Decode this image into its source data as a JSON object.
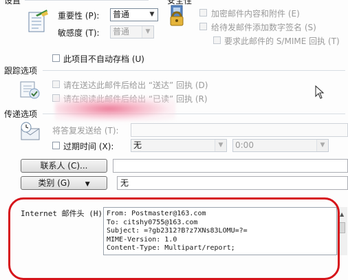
{
  "settings": {
    "title": "设置",
    "importance_label": "重要性 (P):",
    "importance_value": "普通",
    "sensitivity_label": "敏感度 (T):",
    "sensitivity_value": "普通",
    "no_autoarchive": "此项目不自动存档 (U)"
  },
  "security": {
    "title": "安全性",
    "encrypt": "加密邮件内容和附件 (E)",
    "sign": "给待发邮件添加数字签名 (S)",
    "smime_receipt": "要求此邮件的 S/MIME 回执 (T)"
  },
  "tracking": {
    "title": "跟踪选项",
    "delivery_receipt": "请在送达此邮件后给出 “送达” 回执 (D)",
    "read_receipt": "请在阅读此邮件后给出 “已读” 回执 (R)"
  },
  "delivery": {
    "title": "传递选项",
    "reply_to_label": "将答复发送给 (T):",
    "expires_label": "过期时间 (X):",
    "expires_date": "无",
    "expires_time": "0:00"
  },
  "contacts_button": "联系人 (C)...",
  "category_button": "类别 (G)",
  "category_value": "无",
  "headers": {
    "label": "Internet 邮件头 (H):",
    "lines": [
      "From: Postmaster@163.com",
      "To: citshy0755@163.com",
      "Subject: =?gb2312?B?z7XNs83LOMU=?=",
      "MIME-Version: 1.0",
      "Content-Type: Multipart/report;"
    ]
  },
  "icons": [
    "properties-icon",
    "security-lock-icon",
    "tracking-icon",
    "delivery-icon",
    "mouse-cursor-icon"
  ]
}
